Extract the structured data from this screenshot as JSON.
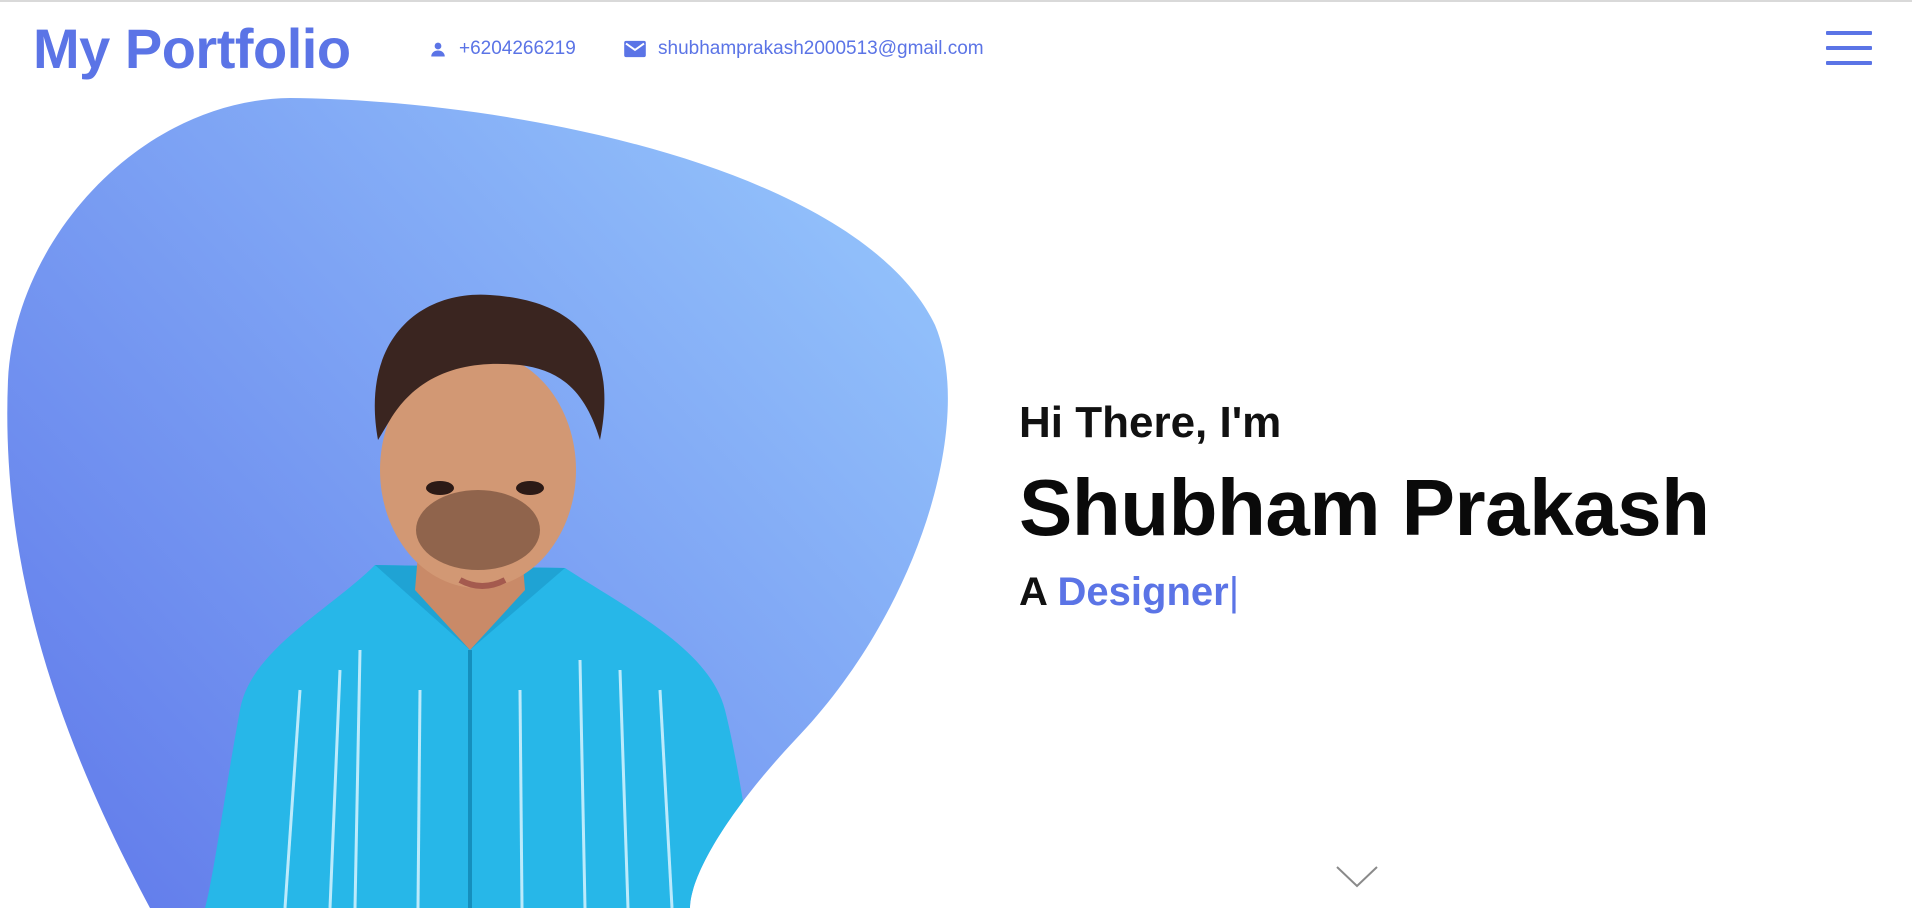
{
  "header": {
    "logo": "My Portfolio",
    "phone": "+6204266219",
    "email": "shubhamprakash2000513@gmail.com",
    "menu_icon": "hamburger-icon"
  },
  "hero": {
    "greeting": "Hi There, I'm",
    "name": "Shubham Prakash",
    "role_prefix": "A",
    "role_typed": "Designer",
    "cursor": "|",
    "profile_photo": "person-portrait",
    "scroll_icon": "chevron-down-icon"
  },
  "colors": {
    "accent": "#5b74e6",
    "blob_start": "#5f78ea",
    "blob_end": "#93c2fb",
    "shirt": "#27b7e8"
  }
}
